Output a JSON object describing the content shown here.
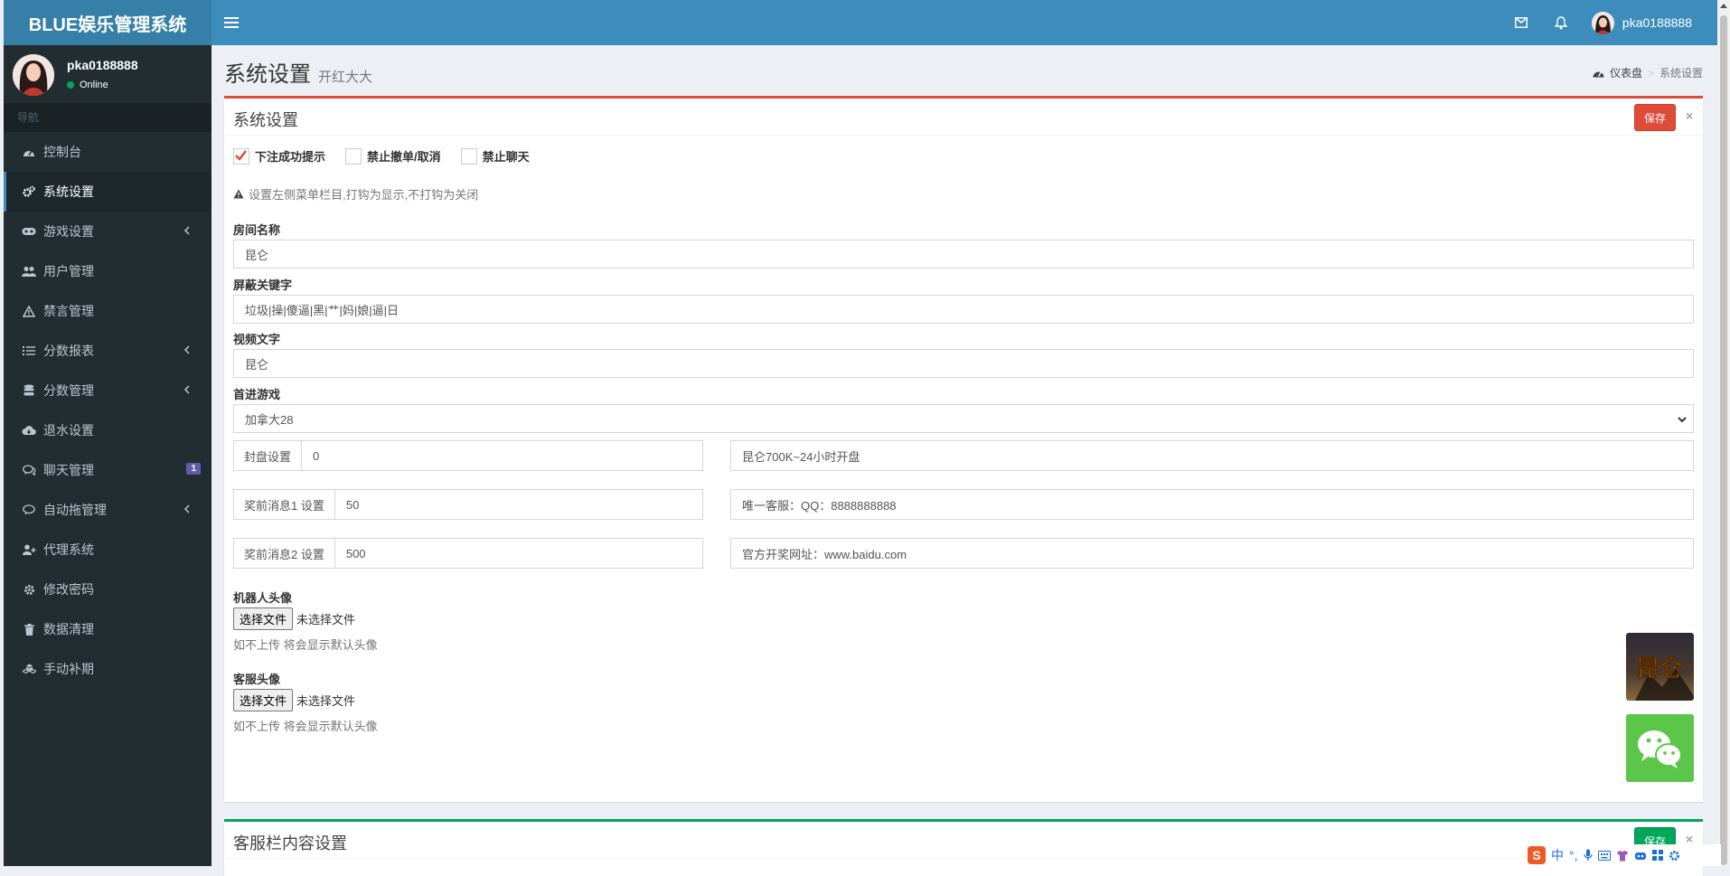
{
  "app": {
    "logo": "BLUE娱乐管理系统"
  },
  "navbar": {
    "username": "pka0188888"
  },
  "sidebar": {
    "user": {
      "name": "pka0188888",
      "status": "Online"
    },
    "header": "导航",
    "items": [
      {
        "label": "控制台"
      },
      {
        "label": "系统设置"
      },
      {
        "label": "游戏设置"
      },
      {
        "label": "用户管理"
      },
      {
        "label": "禁言管理"
      },
      {
        "label": "分数报表"
      },
      {
        "label": "分数管理"
      },
      {
        "label": "退水设置"
      },
      {
        "label": "聊天管理",
        "badge": "1"
      },
      {
        "label": "自动拖管理"
      },
      {
        "label": "代理系统"
      },
      {
        "label": "修改密码"
      },
      {
        "label": "数据清理"
      },
      {
        "label": "手动补期"
      }
    ]
  },
  "page": {
    "title": "系统设置",
    "subtitle": "开红大大",
    "breadcrumb": {
      "home": "仪表盘",
      "current": "系统设置"
    }
  },
  "settings": {
    "title": "系统设置",
    "save_label": "保存",
    "checks": [
      {
        "label": "下注成功提示",
        "checked": true
      },
      {
        "label": "禁止撤单/取消",
        "checked": false
      },
      {
        "label": "禁止聊天",
        "checked": false
      }
    ],
    "hint": "设置左侧菜单栏目,打钩为显示,不打钩为关闭",
    "room_name": {
      "label": "房间名称",
      "value": "昆仑"
    },
    "keywords": {
      "label": "屏蔽关键字",
      "value": "垃圾|操|傻逼|黑|艹|妈|娘|逼|日"
    },
    "video_text": {
      "label": "视频文字",
      "value": "昆仑"
    },
    "first_game": {
      "label": "首进游戏",
      "value": "加拿大28"
    },
    "close_setting": {
      "label": "封盘设置",
      "value": "0",
      "right": "昆仑700K~24小时开盘"
    },
    "msg1": {
      "label": "奖前消息1 设置",
      "value": "50",
      "right": "唯一客服：QQ：8888888888"
    },
    "msg2": {
      "label": "奖前消息2 设置",
      "value": "500",
      "right": "官方开奖网址：www.baidu.com"
    },
    "robot_avatar": {
      "label": "机器人头像",
      "button": "选择文件",
      "status": "未选择文件",
      "help": "如不上传 将会显示默认头像",
      "thumb_text": "昆仑"
    },
    "service_avatar": {
      "label": "客服头像",
      "button": "选择文件",
      "status": "未选择文件",
      "help": "如不上传 将会显示默认头像"
    }
  },
  "service_panel": {
    "title": "客服栏内容设置",
    "save_label": "保存"
  },
  "ime": {
    "lang": "中"
  },
  "colors": {
    "primary": "#3c8dbc",
    "sidebar": "#222d32",
    "danger": "#dd4b39",
    "success": "#00a65a",
    "badge": "#605ca8"
  }
}
